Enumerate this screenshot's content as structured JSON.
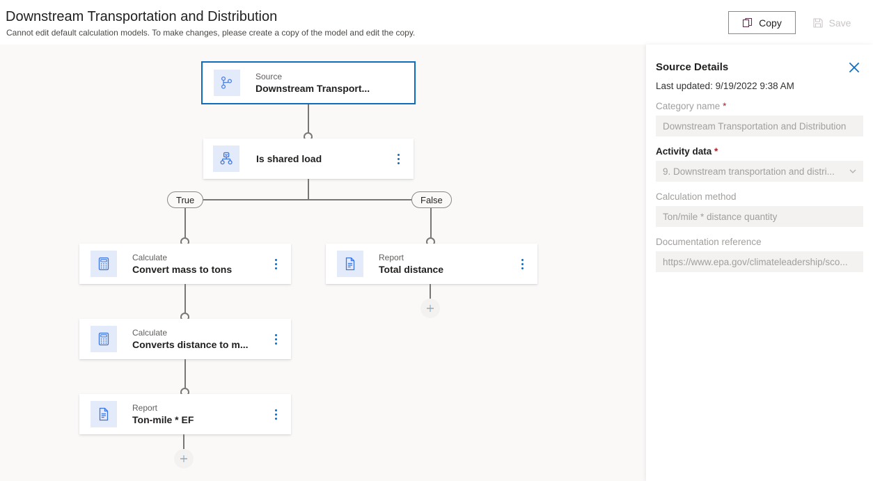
{
  "header": {
    "title": "Downstream Transportation and Distribution",
    "subtitle": "Cannot edit default calculation models. To make changes, please create a copy of the model and edit the copy.",
    "copy_label": "Copy",
    "save_label": "Save",
    "copy_icon": "copy-icon",
    "save_icon": "save-floppy-icon"
  },
  "flow": {
    "nodes": [
      {
        "id": "source",
        "kind": "Source",
        "name": "Downstream Transport...",
        "icon": "branch-source-icon",
        "selected": true,
        "has_menu": false
      },
      {
        "id": "condition",
        "kind": "",
        "name": "Is shared load",
        "icon": "decision-branch-icon",
        "selected": false,
        "has_menu": true
      },
      {
        "id": "calc-mass",
        "kind": "Calculate",
        "name": "Convert mass to tons",
        "icon": "calculator-icon",
        "selected": false,
        "has_menu": true
      },
      {
        "id": "calc-distance",
        "kind": "Calculate",
        "name": "Converts distance to m...",
        "icon": "calculator-icon",
        "selected": false,
        "has_menu": true
      },
      {
        "id": "report-tonmile",
        "kind": "Report",
        "name": "Ton-mile * EF",
        "icon": "document-report-icon",
        "selected": false,
        "has_menu": true
      },
      {
        "id": "report-distance",
        "kind": "Report",
        "name": "Total distance",
        "icon": "document-report-icon",
        "selected": false,
        "has_menu": true
      }
    ],
    "branches": {
      "true_label": "True",
      "false_label": "False"
    },
    "add_icon": "plus-icon"
  },
  "panel": {
    "title": "Source Details",
    "close_icon": "close-x-icon",
    "last_updated": "Last updated: 9/19/2022 9:38 AM",
    "fields": [
      {
        "label": "Category name",
        "required": true,
        "strong": false,
        "value": "Downstream Transportation and Distribution",
        "dropdown": false
      },
      {
        "label": "Activity data",
        "required": true,
        "strong": true,
        "value": "9. Downstream transportation and distri...",
        "dropdown": true,
        "chevron_icon": "chevron-down-icon"
      },
      {
        "label": "Calculation method",
        "required": false,
        "strong": false,
        "value": "Ton/mile * distance quantity",
        "dropdown": false
      },
      {
        "label": "Documentation reference",
        "required": false,
        "strong": false,
        "value": "https://www.epa.gov/climateleadership/sco...",
        "dropdown": false
      }
    ]
  },
  "colors": {
    "accent": "#0f6cbd",
    "canvas_bg": "#faf9f8",
    "panel_bg": "#ffffff",
    "connector": "#797775",
    "required_star": "#a4262c"
  }
}
